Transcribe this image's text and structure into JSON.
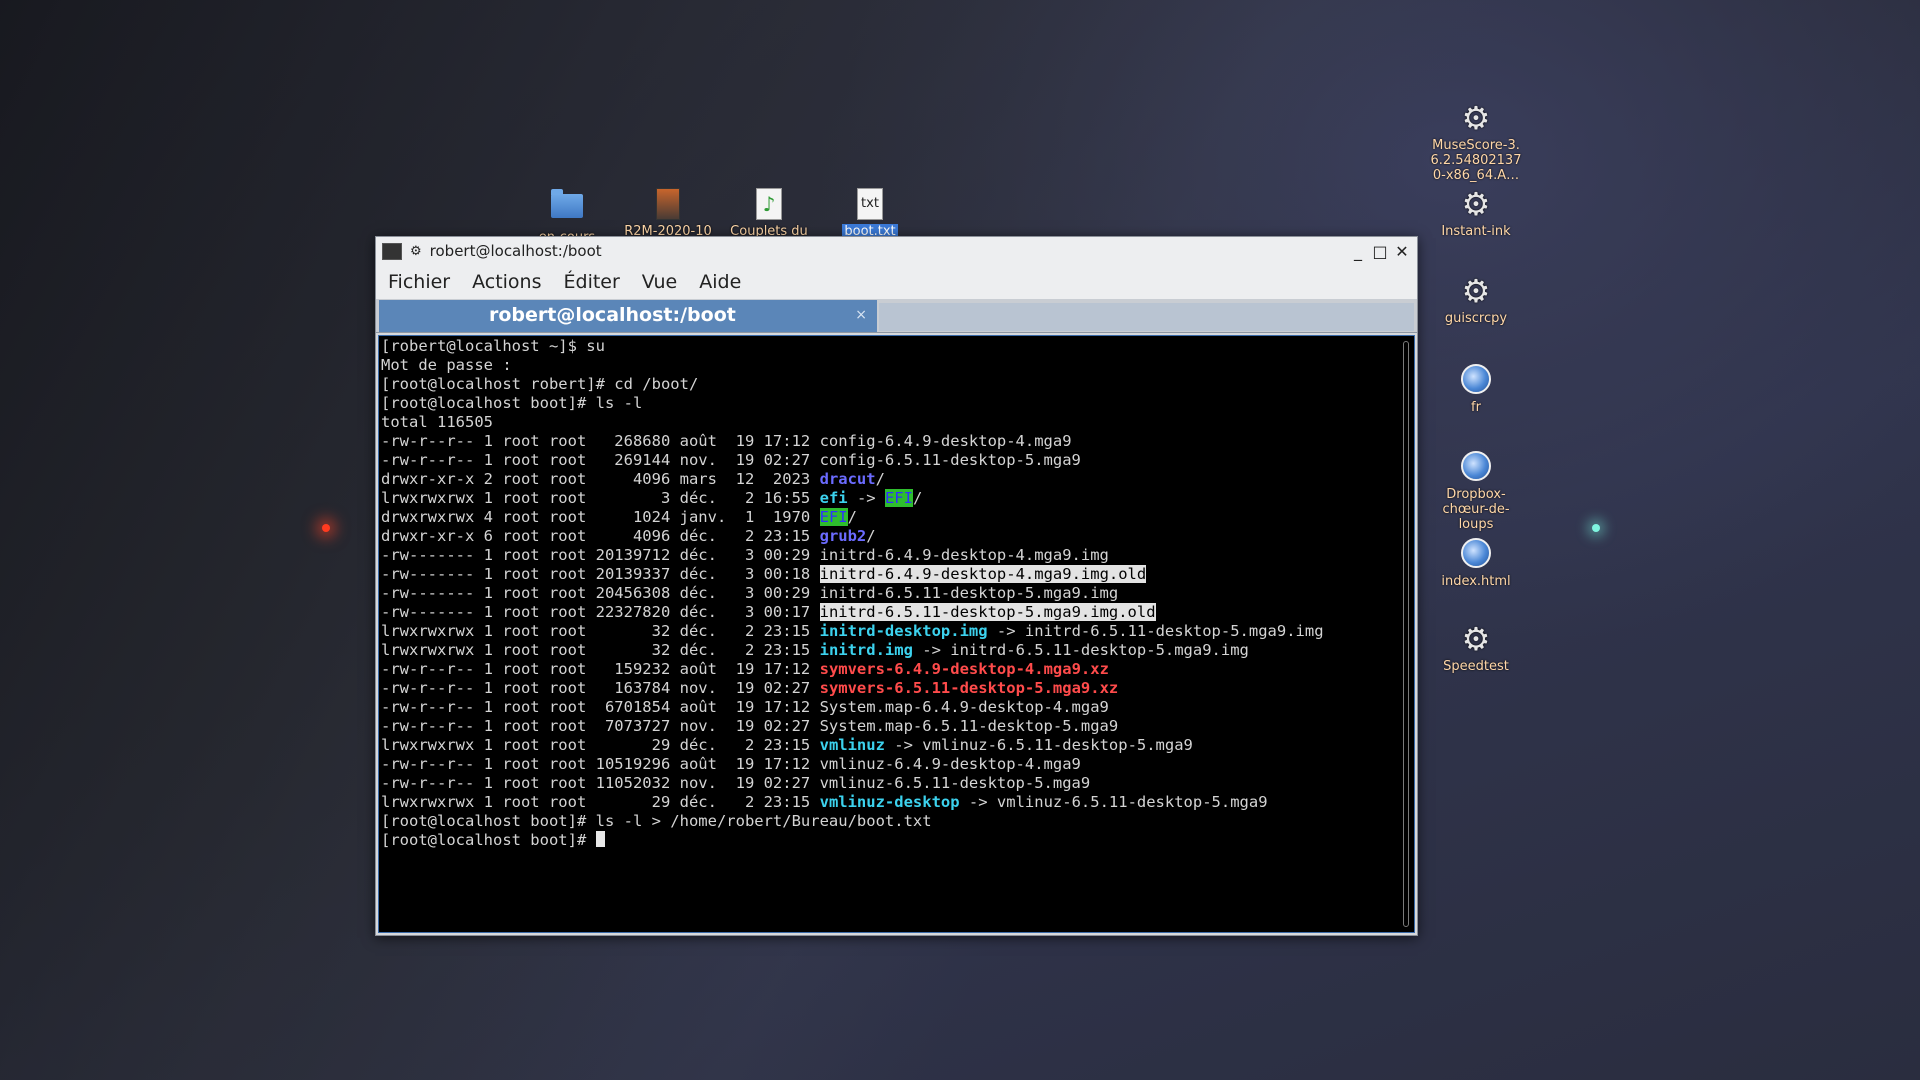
{
  "desktop": {
    "top_icons": [
      {
        "label": "en-cours",
        "icon": "folder-icon"
      },
      {
        "label": "R2M-2020-10",
        "icon": "image-file-icon"
      },
      {
        "label": "Couplets du",
        "icon": "audio-file-icon"
      },
      {
        "label": "boot.txt",
        "icon": "text-file-icon",
        "selected": true
      }
    ],
    "right_icons": [
      {
        "label": "MuseScore-3.\n6.2.54802137\n0-x86_64.A…",
        "icon": "gear-icon"
      },
      {
        "label": "Instant-ink",
        "icon": "gear-icon"
      },
      {
        "label": "guiscrcpy",
        "icon": "gear-icon"
      },
      {
        "label": "fr",
        "icon": "web-link-icon"
      },
      {
        "label": "Dropbox-\nchœur-de-\nloups",
        "icon": "web-link-icon"
      },
      {
        "label": "index.html",
        "icon": "web-link-icon"
      },
      {
        "label": "Speedtest",
        "icon": "gear-icon"
      }
    ],
    "txt_glyph": "txt"
  },
  "window": {
    "title": "robert@localhost:/boot",
    "menu": [
      "Fichier",
      "Actions",
      "Éditer",
      "Vue",
      "Aide"
    ],
    "tab_label": "robert@localhost:/boot",
    "tab_close": "×",
    "buttons": {
      "minimize": "_",
      "maximize": "□",
      "close": "✕"
    }
  },
  "terminal": {
    "lines": [
      [
        {
          "t": "[robert@localhost ~]$ su"
        }
      ],
      [
        {
          "t": "Mot de passe :"
        }
      ],
      [
        {
          "t": "[root@localhost robert]# cd /boot/"
        }
      ],
      [
        {
          "t": "[root@localhost boot]# ls -l"
        }
      ],
      [
        {
          "t": "total 116505"
        }
      ],
      [
        {
          "t": "-rw-r--r-- 1 root root   268680 août  19 17:12 config-6.4.9-desktop-4.mga9"
        }
      ],
      [
        {
          "t": "-rw-r--r-- 1 root root   269144 nov.  19 02:27 config-6.5.11-desktop-5.mga9"
        }
      ],
      [
        {
          "t": "drwxr-xr-x 2 root root     4096 mars  12  2023 "
        },
        {
          "t": "dracut",
          "c": "blue"
        },
        {
          "t": "/"
        }
      ],
      [
        {
          "t": "lrwxrwxrwx 1 root root        3 déc.   2 16:55 "
        },
        {
          "t": "efi",
          "c": "cyan"
        },
        {
          "t": " -> "
        },
        {
          "t": "EFI",
          "c": "grn"
        },
        {
          "t": "/"
        }
      ],
      [
        {
          "t": "drwxrwxrwx 4 root root     1024 janv.  1  1970 "
        },
        {
          "t": "EFI",
          "c": "grn"
        },
        {
          "t": "/"
        }
      ],
      [
        {
          "t": "drwxr-xr-x 6 root root     4096 déc.   2 23:15 "
        },
        {
          "t": "grub2",
          "c": "blue"
        },
        {
          "t": "/"
        }
      ],
      [
        {
          "t": "-rw------- 1 root root 20139712 déc.   3 00:29 initrd-6.4.9-desktop-4.mga9.img"
        }
      ],
      [
        {
          "t": "-rw------- 1 root root 20139337 déc.   3 00:18 "
        },
        {
          "t": "initrd-6.4.9-desktop-4.mga9.img.old",
          "c": "hl"
        }
      ],
      [
        {
          "t": "-rw------- 1 root root 20456308 déc.   3 00:29 initrd-6.5.11-desktop-5.mga9.img"
        }
      ],
      [
        {
          "t": "-rw------- 1 root root 22327820 déc.   3 00:17 "
        },
        {
          "t": "initrd-6.5.11-desktop-5.mga9.img.old",
          "c": "hl"
        }
      ],
      [
        {
          "t": "lrwxrwxrwx 1 root root       32 déc.   2 23:15 "
        },
        {
          "t": "initrd-desktop.img",
          "c": "cyan"
        },
        {
          "t": " -> initrd-6.5.11-desktop-5.mga9.img"
        }
      ],
      [
        {
          "t": "lrwxrwxrwx 1 root root       32 déc.   2 23:15 "
        },
        {
          "t": "initrd.img",
          "c": "cyan"
        },
        {
          "t": " -> initrd-6.5.11-desktop-5.mga9.img"
        }
      ],
      [
        {
          "t": "-rw-r--r-- 1 root root   159232 août  19 17:12 "
        },
        {
          "t": "symvers-6.4.9-desktop-4.mga9.xz",
          "c": "red"
        }
      ],
      [
        {
          "t": "-rw-r--r-- 1 root root   163784 nov.  19 02:27 "
        },
        {
          "t": "symvers-6.5.11-desktop-5.mga9.xz",
          "c": "red"
        }
      ],
      [
        {
          "t": "-rw-r--r-- 1 root root  6701854 août  19 17:12 System.map-6.4.9-desktop-4.mga9"
        }
      ],
      [
        {
          "t": "-rw-r--r-- 1 root root  7073727 nov.  19 02:27 System.map-6.5.11-desktop-5.mga9"
        }
      ],
      [
        {
          "t": "lrwxrwxrwx 1 root root       29 déc.   2 23:15 "
        },
        {
          "t": "vmlinuz",
          "c": "cyan"
        },
        {
          "t": " -> vmlinuz-6.5.11-desktop-5.mga9"
        }
      ],
      [
        {
          "t": "-rw-r--r-- 1 root root 10519296 août  19 17:12 vmlinuz-6.4.9-desktop-4.mga9"
        }
      ],
      [
        {
          "t": "-rw-r--r-- 1 root root 11052032 nov.  19 02:27 vmlinuz-6.5.11-desktop-5.mga9"
        }
      ],
      [
        {
          "t": "lrwxrwxrwx 1 root root       29 déc.   2 23:15 "
        },
        {
          "t": "vmlinuz-desktop",
          "c": "cyan"
        },
        {
          "t": " -> vmlinuz-6.5.11-desktop-5.mga9"
        }
      ],
      [
        {
          "t": "[root@localhost boot]# ls -l > /home/robert/Bureau/boot.txt"
        }
      ],
      [
        {
          "t": "[root@localhost boot]# "
        },
        {
          "cursor": true
        }
      ]
    ]
  }
}
